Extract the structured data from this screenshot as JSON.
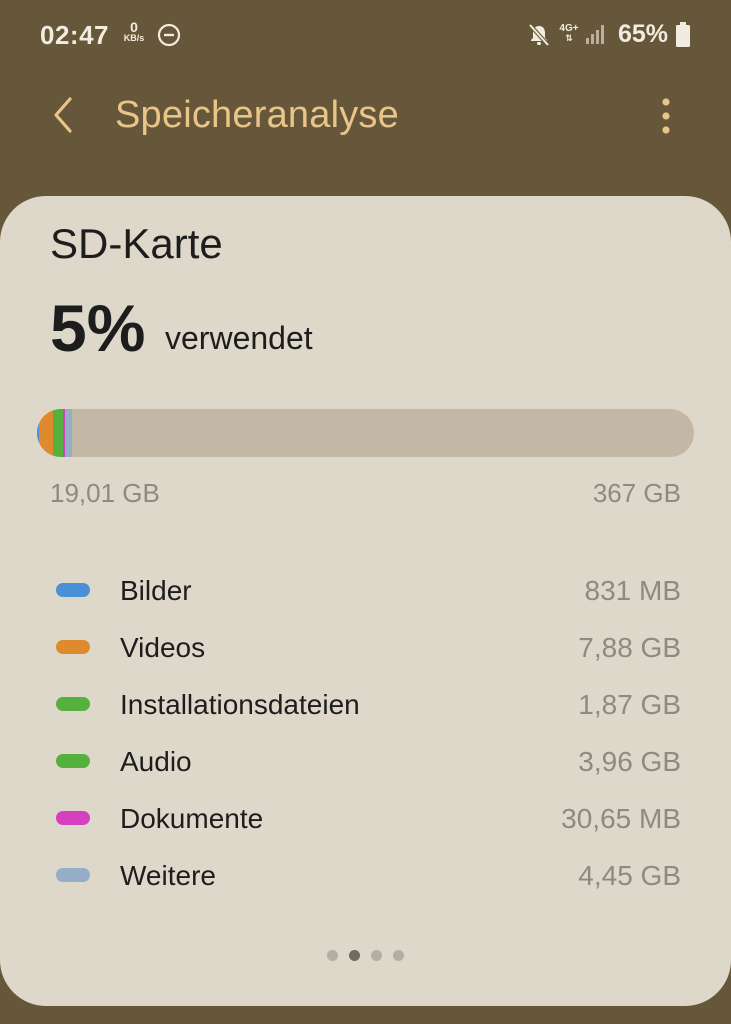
{
  "status_bar": {
    "time": "02:47",
    "speed_value": "0",
    "speed_unit": "KB/s",
    "network": "4G+",
    "battery": "65%",
    "icons": [
      "do-not-disturb-icon",
      "mute-icon",
      "network-4g-icon",
      "signal-icon",
      "battery-icon"
    ]
  },
  "app_bar": {
    "title": "Speicheranalyse",
    "back_icon": "chevron-left-icon",
    "more_icon": "more-vertical-icon"
  },
  "card": {
    "title": "SD-Karte",
    "percent": "5%",
    "percent_label": "verwendet",
    "bar_min": "19,01 GB",
    "bar_max": "367 GB",
    "categories": [
      {
        "label": "Bilder",
        "size": "831 MB",
        "color": "#4a90d6"
      },
      {
        "label": "Videos",
        "size": "7,88 GB",
        "color": "#e08a2e"
      },
      {
        "label": "Installationsdateien",
        "size": "1,87 GB",
        "color": "#55b03e"
      },
      {
        "label": "Audio",
        "size": "3,96 GB",
        "color": "#55b03e"
      },
      {
        "label": "Dokumente",
        "size": "30,65 MB",
        "color": "#d640bf"
      },
      {
        "label": "Weitere",
        "size": "4,45 GB",
        "color": "#93aec6"
      }
    ],
    "usage_fraction": 0.05,
    "page_count": 4,
    "active_page": 1
  },
  "colors": {
    "background": "#66573a",
    "card": "#ded8ca",
    "accent_title": "#e8c588",
    "bar_track": "#c3b8a5"
  }
}
